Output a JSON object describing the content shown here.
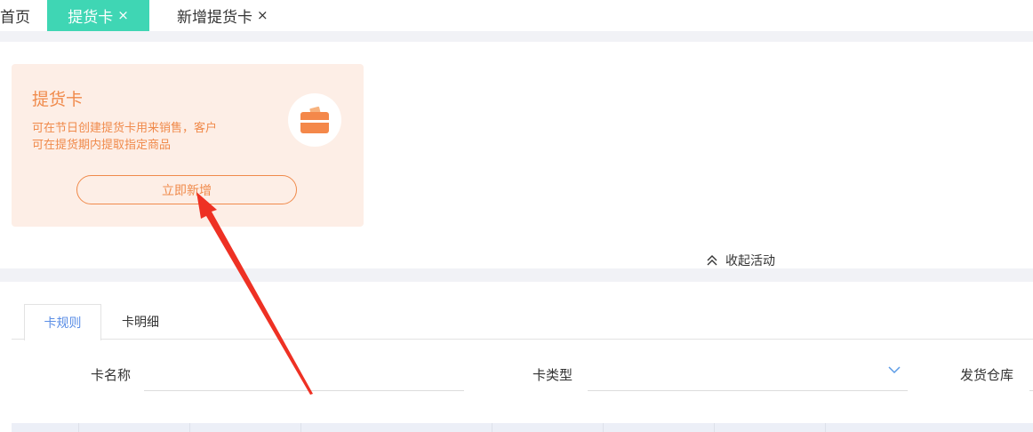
{
  "top_tabs": {
    "home": "首页",
    "active": "提货卡",
    "new": "新增提货卡",
    "close_glyph": "×"
  },
  "card": {
    "title": "提货卡",
    "description": "可在节日创建提货卡用来销售，客户\n可在提货期内提取指定商品",
    "button": "立即新增",
    "icon": "card-icon",
    "accent": "#f08a4b",
    "background": "#fdeee6"
  },
  "collapse_label": "收起活动",
  "tabs": [
    "卡规则",
    "卡明细"
  ],
  "filters": {
    "card_name_label": "卡名称",
    "card_type_label": "卡类型",
    "warehouse_label": "发货仓库"
  },
  "colors": {
    "active_tab": "#3fd6b4",
    "annotation_arrow": "#ee3124",
    "tab_active_text": "#5b8ee6"
  }
}
